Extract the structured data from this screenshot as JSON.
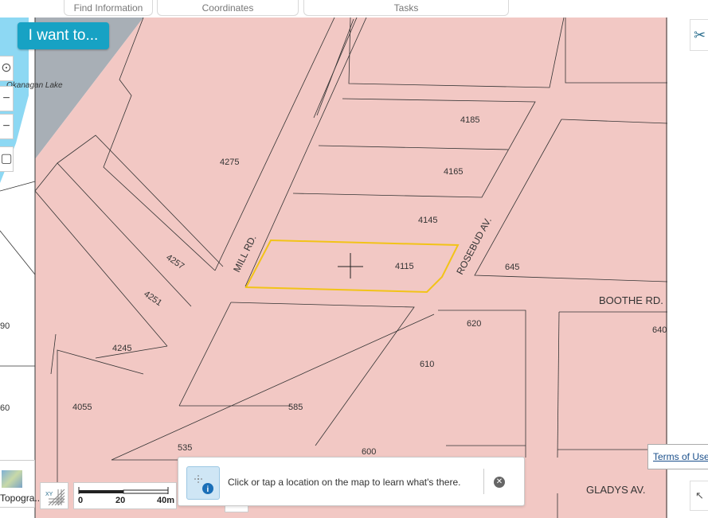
{
  "tabs": {
    "find_information": "Find Information",
    "coordinates": "Coordinates",
    "tasks": "Tasks"
  },
  "i_want_to": "I want to...",
  "map": {
    "water_label": "Okanagan Lake",
    "street_labels": {
      "mill": "MILL RD.",
      "rosebud": "ROSEBUD AV.",
      "boothe": "BOOTHE RD.",
      "gladys": "GLADYS AV."
    },
    "parcels": {
      "p4185": "4185",
      "p4165": "4165",
      "p4145": "4145",
      "p4115": "4115",
      "p4275": "4275",
      "p4257": "4257",
      "p4251": "4251",
      "p4245": "4245",
      "p4055": "4055",
      "p645": "645",
      "p640": "640",
      "p620": "620",
      "p610": "610",
      "p585": "585",
      "p535": "535",
      "p600": "600",
      "p90": "90",
      "p60": "60"
    }
  },
  "scalebar": {
    "zero": "0",
    "mid": "20",
    "max": "40m"
  },
  "basemap_label": "Topogra...",
  "info_panel": {
    "message": "Click or tap a location on the map to learn what's there."
  },
  "terms_link": "Terms of Use",
  "colors": {
    "parcel_fill": "#f2c8c4",
    "water": "#8dd8f3",
    "highlight": "#f2c318",
    "accent": "#17a2c4"
  }
}
